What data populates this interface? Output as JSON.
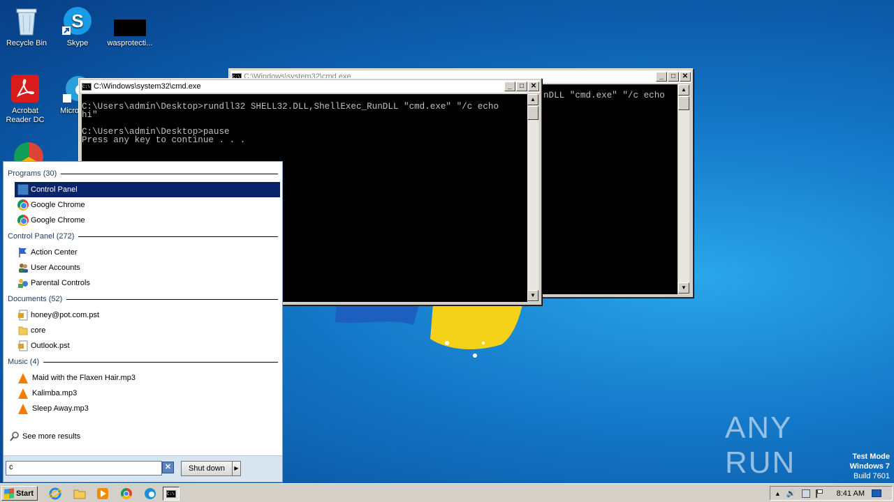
{
  "desktop": {
    "icons": [
      {
        "label": "Recycle Bin"
      },
      {
        "label": "Skype"
      },
      {
        "label": "wasprotecti..."
      },
      {
        "label": "Acrobat Reader DC"
      },
      {
        "label": "Microso..."
      }
    ],
    "watermark": {
      "brand": "ANY RUN",
      "line1": "Test Mode",
      "line2": "Windows 7",
      "line3": "Build 7601"
    }
  },
  "window_back": {
    "title": "C:\\Windows\\system32\\cmd.exe",
    "console_text": "nDLL \"cmd.exe\" \"/c echo"
  },
  "window_front": {
    "title": "C:\\Windows\\system32\\cmd.exe",
    "console_text": "\nC:\\Users\\admin\\Desktop>rundll32 SHELL32.DLL,ShellExec_RunDLL \"cmd.exe\" \"/c echo\nhi\"\n\nC:\\Users\\admin\\Desktop>pause\nPress any key to continue . . ."
  },
  "start_menu": {
    "sections": [
      {
        "header": "Programs (30)",
        "items": [
          "Control Panel",
          "Google Chrome",
          "Google Chrome"
        ]
      },
      {
        "header": "Control Panel (272)",
        "items": [
          "Action Center",
          "User Accounts",
          "Parental Controls"
        ]
      },
      {
        "header": "Documents (52)",
        "items": [
          "honey@pot.com.pst",
          "core",
          "Outlook.pst"
        ]
      },
      {
        "header": "Music (4)",
        "items": [
          "Maid with the Flaxen Hair.mp3",
          "Kalimba.mp3",
          "Sleep Away.mp3"
        ]
      }
    ],
    "see_more": "See more results",
    "search_value": "c",
    "clear_symbol": "✕",
    "shutdown_label": "Shut down",
    "shutdown_arrow": "▶"
  },
  "taskbar": {
    "start_label": "Start",
    "clock": "8:41 AM",
    "tray_arrow": "▲",
    "tray_speaker": "🔊"
  },
  "window_controls": {
    "minimize": "_",
    "maximize": "□",
    "close": "✕"
  },
  "scroll_arrows": {
    "up": "▲",
    "down": "▼"
  }
}
